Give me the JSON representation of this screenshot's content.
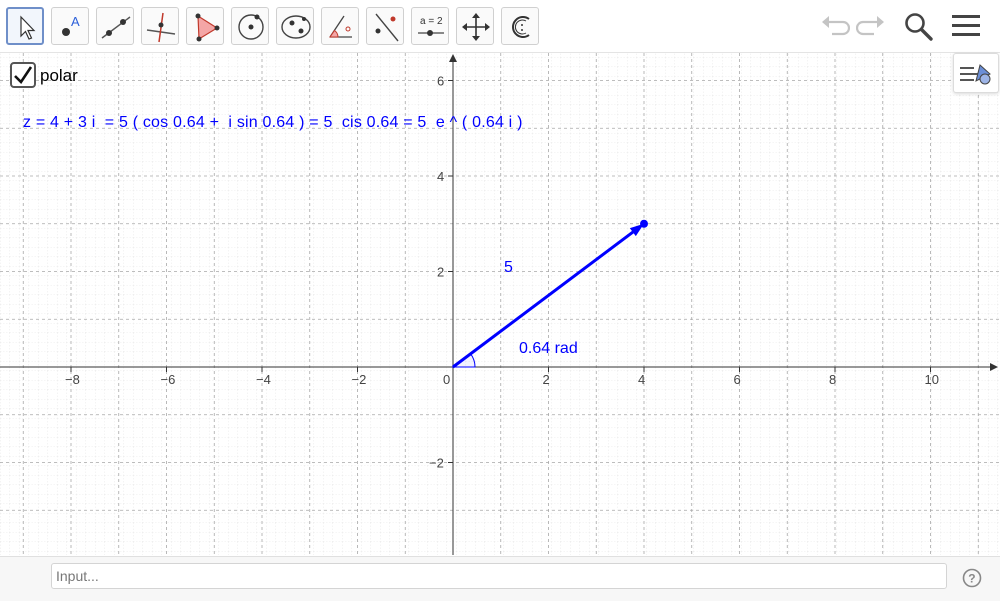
{
  "toolbar": {
    "tools": [
      {
        "name": "move-tool-button",
        "icon": "cursor-arrow-icon"
      },
      {
        "name": "point-tool-button",
        "icon": "point-icon"
      },
      {
        "name": "line-tool-button",
        "icon": "line-through-two-points-icon"
      },
      {
        "name": "perpendicular-line-tool-button",
        "icon": "perpendicular-line-icon"
      },
      {
        "name": "polygon-tool-button",
        "icon": "polygon-icon"
      },
      {
        "name": "circle-tool-button",
        "icon": "circle-center-point-icon"
      },
      {
        "name": "conic-tool-button",
        "icon": "ellipse-icon"
      },
      {
        "name": "angle-tool-button",
        "icon": "angle-icon"
      },
      {
        "name": "reflect-tool-button",
        "icon": "reflect-about-line-icon"
      },
      {
        "name": "slider-tool-button",
        "icon": "slider-icon",
        "label": "a = 2"
      },
      {
        "name": "move-graphics-view-tool-button",
        "icon": "four-way-arrows-icon"
      },
      {
        "name": "complex-number-tool-button",
        "icon": "complex-c-icon"
      }
    ],
    "undo_icon": "undo-icon",
    "redo_icon": "redo-icon",
    "search_icon": "search-icon",
    "menu_icon": "hamburger-menu-icon"
  },
  "graphics": {
    "checkbox": {
      "label": "polar",
      "checked": true
    },
    "formula": "z = 4 + 3 i  = 5 ( cos 0.64 +  i sin 0.64 ) = 5  cis 0.64 = 5  e ^ ( 0.64 i )",
    "vector": {
      "from": [
        0,
        0
      ],
      "to": [
        4,
        3
      ],
      "color": "#0000ff"
    },
    "length_label": "5",
    "angle_label": "0.64 rad",
    "x_ticks": [
      "−8",
      "−6",
      "−4",
      "−2",
      "0",
      "2",
      "4",
      "6",
      "8",
      "10"
    ],
    "y_ticks": [
      "6",
      "4",
      "2",
      "−2"
    ],
    "x_range": [
      -9.5,
      11.3
    ],
    "y_range": [
      -3.9,
      6.6
    ],
    "grid": true,
    "stylebar_icon": "style-bar-toggle-icon"
  },
  "input_bar": {
    "placeholder": "Input..."
  },
  "help_icon": "help-icon"
}
